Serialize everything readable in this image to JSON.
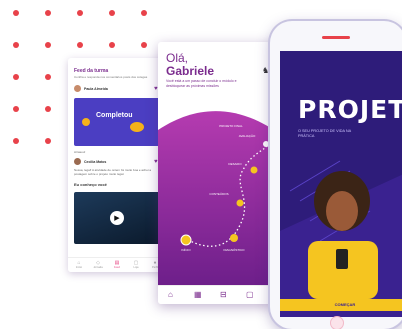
{
  "colors": {
    "accent": "#7b2c8e",
    "brand_red": "#e8424a",
    "purple_bg": "#3a2290",
    "yellow": "#f5c520",
    "pink": "#e84f8a"
  },
  "feed_screen": {
    "title": "Feed da turma",
    "subtitle": "Confira e responda nos comentários posts dos colegas",
    "post_author": "Paula Almeida",
    "card_label": "Completou",
    "post_meta": "Arrasou!",
    "post2_author": "Cecilia Matos",
    "post2_body": "Nossa, legal! A atividade de ontem foi muito boa e achei a postagem sobre o projeto muito legal.",
    "section_title": "Eu conheço você",
    "nav": [
      {
        "label": "Início",
        "icon": "home-icon"
      },
      {
        "label": "Jornada",
        "icon": "map-icon"
      },
      {
        "label": "Feed",
        "icon": "feed-icon"
      },
      {
        "label": "Loja",
        "icon": "bag-icon"
      },
      {
        "label": "Perfil",
        "icon": "user-icon"
      }
    ]
  },
  "journey_screen": {
    "greeting_line1": "Olá,",
    "greeting_name": "Gabriele",
    "subtitle": "Você está a um passo de concluir o módulo e desbloquear as próximas missões",
    "steps": [
      "INÍCIO",
      "DIAGNÓSTICO",
      "CONTEÚDOS",
      "DESAFIO",
      "AVALIAÇÃO",
      "PROJETO FINAL"
    ],
    "nav_icons": [
      "home-icon",
      "book-icon",
      "gamepad-icon",
      "bag-icon"
    ]
  },
  "phone_screen": {
    "hero_title": "PROJET",
    "hero_subtitle": "O SEU PROJETO DE VIDA NA PRÁTICA",
    "cta_label": "COMEÇAR"
  }
}
